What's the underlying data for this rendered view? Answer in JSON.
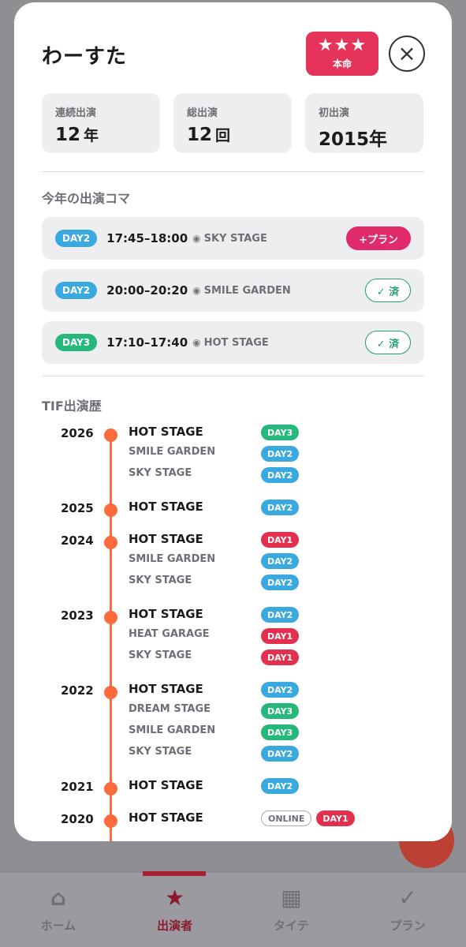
{
  "artist": {
    "name": "わーすた",
    "rank_stars": "★★★",
    "rank_label": "本命",
    "close_icon": "×"
  },
  "stats": [
    {
      "label": "連続出演",
      "value": "12",
      "unit": "年"
    },
    {
      "label": "総出演",
      "value": "12",
      "unit": "回"
    },
    {
      "label": "初出演",
      "value": "2015年",
      "unit": ""
    }
  ],
  "this_year": {
    "title": "今年の出演コマ",
    "slots": [
      {
        "day": "DAY2",
        "day_color": "blue",
        "time": "17:45–18:00",
        "radio": "◉",
        "stage": "SKY STAGE",
        "action": "plan",
        "action_label": "+プラン"
      },
      {
        "day": "DAY2",
        "day_color": "blue",
        "time": "20:00–20:20",
        "radio": "◉",
        "stage": "SMILE GARDEN",
        "action": "done",
        "action_label": "✓ 済"
      },
      {
        "day": "DAY3",
        "day_color": "green",
        "time": "17:10–17:40",
        "radio": "◉",
        "stage": "HOT STAGE",
        "action": "done",
        "action_label": "✓ 済"
      }
    ]
  },
  "history": {
    "title": "TIF出演歴",
    "years": [
      {
        "year": "2026",
        "entries": [
          {
            "stage": "HOT STAGE",
            "tags": [
              {
                "label": "DAY3",
                "color": "green"
              }
            ]
          },
          {
            "stage": "SMILE GARDEN",
            "tags": [
              {
                "label": "DAY2",
                "color": "blue"
              }
            ]
          },
          {
            "stage": "SKY STAGE",
            "tags": [
              {
                "label": "DAY2",
                "color": "blue"
              }
            ]
          }
        ]
      },
      {
        "year": "2025",
        "entries": [
          {
            "stage": "HOT STAGE",
            "tags": [
              {
                "label": "DAY2",
                "color": "blue"
              }
            ]
          }
        ]
      },
      {
        "year": "2024",
        "entries": [
          {
            "stage": "HOT STAGE",
            "tags": [
              {
                "label": "DAY1",
                "color": "red"
              }
            ]
          },
          {
            "stage": "SMILE GARDEN",
            "tags": [
              {
                "label": "DAY2",
                "color": "blue"
              }
            ]
          },
          {
            "stage": "SKY STAGE",
            "tags": [
              {
                "label": "DAY2",
                "color": "blue"
              }
            ]
          }
        ]
      },
      {
        "year": "2023",
        "entries": [
          {
            "stage": "HOT STAGE",
            "tags": [
              {
                "label": "DAY2",
                "color": "blue"
              }
            ]
          },
          {
            "stage": "HEAT GARAGE",
            "tags": [
              {
                "label": "DAY1",
                "color": "red"
              }
            ]
          },
          {
            "stage": "SKY STAGE",
            "tags": [
              {
                "label": "DAY1",
                "color": "red"
              }
            ]
          }
        ]
      },
      {
        "year": "2022",
        "entries": [
          {
            "stage": "HOT STAGE",
            "tags": [
              {
                "label": "DAY2",
                "color": "blue"
              }
            ]
          },
          {
            "stage": "DREAM STAGE",
            "tags": [
              {
                "label": "DAY3",
                "color": "green"
              }
            ]
          },
          {
            "stage": "SMILE GARDEN",
            "tags": [
              {
                "label": "DAY3",
                "color": "green"
              }
            ]
          },
          {
            "stage": "SKY STAGE",
            "tags": [
              {
                "label": "DAY2",
                "color": "blue"
              }
            ]
          }
        ]
      },
      {
        "year": "2021",
        "entries": [
          {
            "stage": "HOT STAGE",
            "tags": [
              {
                "label": "DAY2",
                "color": "blue"
              }
            ]
          }
        ]
      },
      {
        "year": "2020",
        "entries": [
          {
            "stage": "HOT STAGE",
            "tags": [
              {
                "label": "ONLINE",
                "color": "outline"
              },
              {
                "label": "DAY1",
                "color": "red"
              }
            ]
          }
        ]
      }
    ]
  },
  "bottom_nav": {
    "items": [
      {
        "label": "ホーム",
        "icon": "⌂",
        "icon_name": "home-icon",
        "active": false
      },
      {
        "label": "出演者",
        "icon": "★",
        "icon_name": "star-icon",
        "active": true
      },
      {
        "label": "タイテ",
        "icon": "▦",
        "icon_name": "grid-icon",
        "active": false
      },
      {
        "label": "プラン",
        "icon": "✓",
        "icon_name": "check-icon",
        "active": false
      }
    ]
  },
  "colors": {
    "accent_pink": "#e6335a",
    "timeline_orange": "#ff6a3d",
    "day_blue": "#3aa9df",
    "day_green": "#25b87a",
    "day_red": "#e3304f"
  }
}
